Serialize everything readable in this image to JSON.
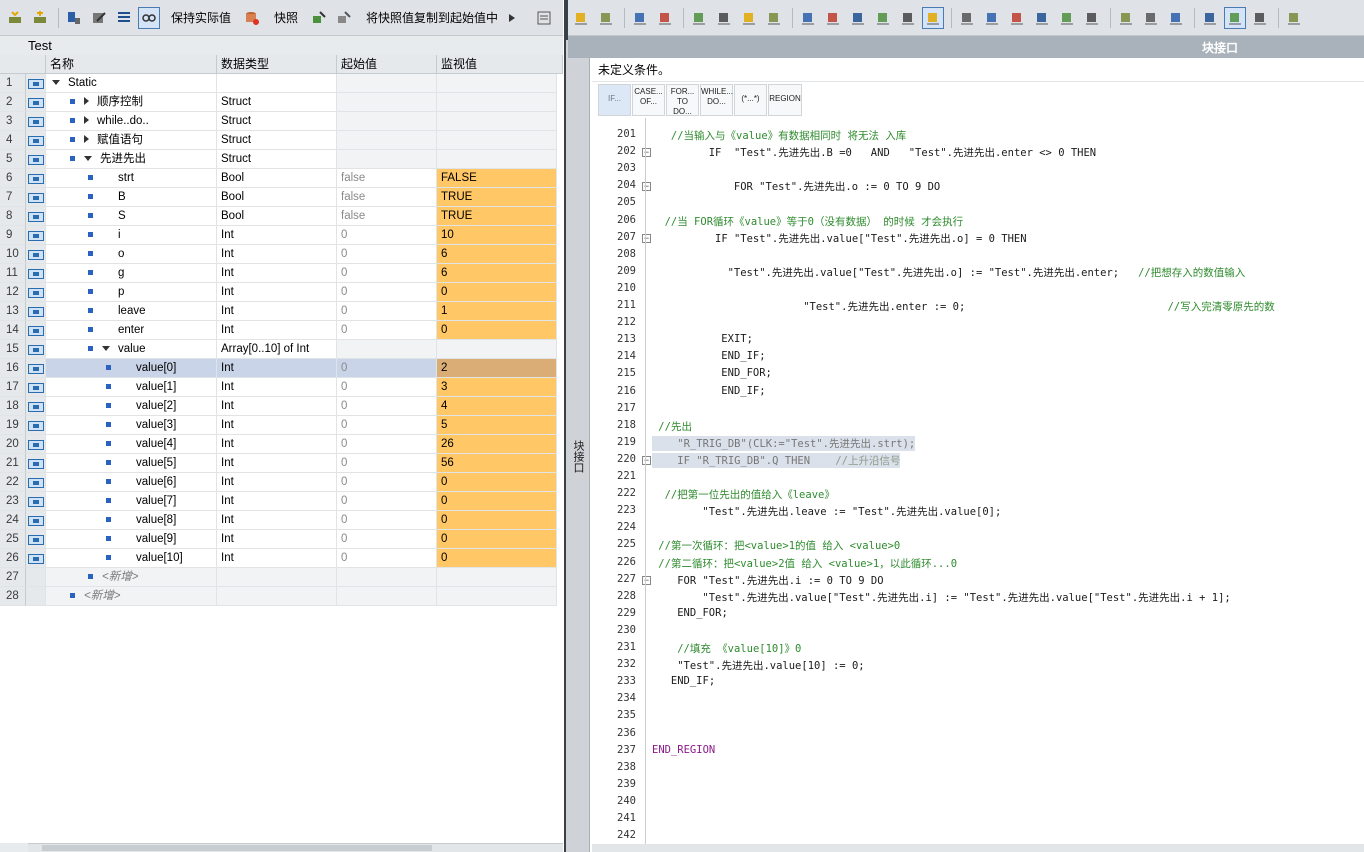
{
  "left_toolbar": {
    "keep_actual": "保持实际值",
    "snapshot": "快照",
    "copy_snapshot": "将快照值复制到起始值中"
  },
  "block_title": "Test",
  "columns": [
    "名称",
    "数据类型",
    "起始值",
    "监视值"
  ],
  "rows": [
    {
      "num": "1",
      "name": "Static",
      "type": "",
      "start": "",
      "monitor": "",
      "level": 0,
      "expander": "down",
      "marker": false
    },
    {
      "num": "2",
      "name": "顺序控制",
      "type": "Struct",
      "start": "",
      "monitor": "",
      "level": 1,
      "expander": "right",
      "marker": true
    },
    {
      "num": "3",
      "name": "while..do..",
      "type": "Struct",
      "start": "",
      "monitor": "",
      "level": 1,
      "expander": "right",
      "marker": true
    },
    {
      "num": "4",
      "name": "赋值语句",
      "type": "Struct",
      "start": "",
      "monitor": "",
      "level": 1,
      "expander": "right",
      "marker": true
    },
    {
      "num": "5",
      "name": "先进先出",
      "type": "Struct",
      "start": "",
      "monitor": "",
      "level": 1,
      "expander": "down",
      "marker": true
    },
    {
      "num": "6",
      "name": "strt",
      "type": "Bool",
      "start": "false",
      "monitor": "FALSE",
      "level": 2,
      "expander": "none",
      "marker": true
    },
    {
      "num": "7",
      "name": "B",
      "type": "Bool",
      "start": "false",
      "monitor": "TRUE",
      "level": 2,
      "expander": "none",
      "marker": true
    },
    {
      "num": "8",
      "name": "S",
      "type": "Bool",
      "start": "false",
      "monitor": "TRUE",
      "level": 2,
      "expander": "none",
      "marker": true
    },
    {
      "num": "9",
      "name": "i",
      "type": "Int",
      "start": "0",
      "monitor": "10",
      "level": 2,
      "expander": "none",
      "marker": true
    },
    {
      "num": "10",
      "name": "o",
      "type": "Int",
      "start": "0",
      "monitor": "6",
      "level": 2,
      "expander": "none",
      "marker": true
    },
    {
      "num": "11",
      "name": "g",
      "type": "Int",
      "start": "0",
      "monitor": "6",
      "level": 2,
      "expander": "none",
      "marker": true
    },
    {
      "num": "12",
      "name": "p",
      "type": "Int",
      "start": "0",
      "monitor": "0",
      "level": 2,
      "expander": "none",
      "marker": true
    },
    {
      "num": "13",
      "name": "leave",
      "type": "Int",
      "start": "0",
      "monitor": "1",
      "level": 2,
      "expander": "none",
      "marker": true
    },
    {
      "num": "14",
      "name": "enter",
      "type": "Int",
      "start": "0",
      "monitor": "0",
      "level": 2,
      "expander": "none",
      "marker": true
    },
    {
      "num": "15",
      "name": "value",
      "type": "Array[0..10] of Int",
      "start": "",
      "monitor": "",
      "level": 2,
      "expander": "down",
      "marker": true
    },
    {
      "num": "16",
      "name": "value[0]",
      "type": "Int",
      "start": "0",
      "monitor": "2",
      "level": 3,
      "expander": "none",
      "marker": true,
      "selected": true
    },
    {
      "num": "17",
      "name": "value[1]",
      "type": "Int",
      "start": "0",
      "monitor": "3",
      "level": 3,
      "expander": "none",
      "marker": true
    },
    {
      "num": "18",
      "name": "value[2]",
      "type": "Int",
      "start": "0",
      "monitor": "4",
      "level": 3,
      "expander": "none",
      "marker": true
    },
    {
      "num": "19",
      "name": "value[3]",
      "type": "Int",
      "start": "0",
      "monitor": "5",
      "level": 3,
      "expander": "none",
      "marker": true
    },
    {
      "num": "20",
      "name": "value[4]",
      "type": "Int",
      "start": "0",
      "monitor": "26",
      "level": 3,
      "expander": "none",
      "marker": true
    },
    {
      "num": "21",
      "name": "value[5]",
      "type": "Int",
      "start": "0",
      "monitor": "56",
      "level": 3,
      "expander": "none",
      "marker": true
    },
    {
      "num": "22",
      "name": "value[6]",
      "type": "Int",
      "start": "0",
      "monitor": "0",
      "level": 3,
      "expander": "none",
      "marker": true
    },
    {
      "num": "23",
      "name": "value[7]",
      "type": "Int",
      "start": "0",
      "monitor": "0",
      "level": 3,
      "expander": "none",
      "marker": true
    },
    {
      "num": "24",
      "name": "value[8]",
      "type": "Int",
      "start": "0",
      "monitor": "0",
      "level": 3,
      "expander": "none",
      "marker": true
    },
    {
      "num": "25",
      "name": "value[9]",
      "type": "Int",
      "start": "0",
      "monitor": "0",
      "level": 3,
      "expander": "none",
      "marker": true
    },
    {
      "num": "26",
      "name": "value[10]",
      "type": "Int",
      "start": "0",
      "monitor": "0",
      "level": 3,
      "expander": "none",
      "marker": true
    },
    {
      "num": "27",
      "name": "<新增>",
      "type": "",
      "start": "",
      "monitor": "",
      "level": 2,
      "expander": "none",
      "marker": true,
      "add": true
    },
    {
      "num": "28",
      "name": "<新增>",
      "type": "",
      "start": "",
      "monitor": "",
      "level": 1,
      "expander": "none",
      "marker": true,
      "add": true
    }
  ],
  "side_tab": "块接口",
  "interface_bar": {
    "label": "块接口"
  },
  "condition_text": "未定义条件。",
  "snippets": [
    {
      "l1": "IF...",
      "l2": ""
    },
    {
      "l1": "CASE...",
      "l2": "OF..."
    },
    {
      "l1": "FOR...",
      "l2": "TO DO..."
    },
    {
      "l1": "WHILE...",
      "l2": "DO..."
    },
    {
      "l1": "(*...*)",
      "l2": ""
    },
    {
      "l1": "REGION",
      "l2": ""
    }
  ],
  "code_lines": [
    {
      "n": "201",
      "indent": 3,
      "text": "//当输入与《value》有数据相同时 将无法 入库",
      "cls": "cm"
    },
    {
      "n": "202",
      "indent": 9,
      "text": "IF  \"Test\".先进先出.B =0   AND   \"Test\".先进先出.enter <> 0 THEN",
      "fold": "-"
    },
    {
      "n": "203",
      "indent": 0,
      "text": ""
    },
    {
      "n": "204",
      "indent": 13,
      "text": "FOR \"Test\".先进先出.o := 0 TO 9 DO",
      "fold": "-"
    },
    {
      "n": "205",
      "indent": 0,
      "text": ""
    },
    {
      "n": "206",
      "indent": 2,
      "text": "//当 FOR循环《value》等于0（没有数据） 的时候 才会执行",
      "cls": "cm"
    },
    {
      "n": "207",
      "indent": 10,
      "text": "IF \"Test\".先进先出.value[\"Test\".先进先出.o] = 0 THEN",
      "fold": "-"
    },
    {
      "n": "208",
      "indent": 0,
      "text": ""
    },
    {
      "n": "209",
      "indent": 12,
      "text": "\"Test\".先进先出.value[\"Test\".先进先出.o] := \"Test\".先进先出.enter;   ",
      "tail": "//把想存入的数值输入"
    },
    {
      "n": "210",
      "indent": 0,
      "text": ""
    },
    {
      "n": "211",
      "indent": 24,
      "text": "\"Test\".先进先出.enter := 0;                                ",
      "tail": "//写入完清零原先的数"
    },
    {
      "n": "212",
      "indent": 0,
      "text": ""
    },
    {
      "n": "213",
      "indent": 11,
      "text": "EXIT;"
    },
    {
      "n": "214",
      "indent": 11,
      "text": "END_IF;"
    },
    {
      "n": "215",
      "indent": 11,
      "text": "END_FOR;"
    },
    {
      "n": "216",
      "indent": 11,
      "text": "END_IF;"
    },
    {
      "n": "217",
      "indent": 0,
      "text": ""
    },
    {
      "n": "218",
      "indent": 1,
      "text": "//先出",
      "cls": "cm"
    },
    {
      "n": "219",
      "indent": 0,
      "text": "    \"R_TRIG_DB\"(CLK:=\"Test\".先进先出.strt);",
      "hl": true
    },
    {
      "n": "220",
      "indent": 0,
      "text": "    IF \"R_TRIG_DB\".Q THEN    ",
      "tail": "//上升沿信号",
      "hl": true,
      "fold": "-"
    },
    {
      "n": "221",
      "indent": 0,
      "text": ""
    },
    {
      "n": "222",
      "indent": 2,
      "text": "//把第一位先出的值给入《leave》",
      "cls": "cm"
    },
    {
      "n": "223",
      "indent": 8,
      "text": "\"Test\".先进先出.leave := \"Test\".先进先出.value[0];"
    },
    {
      "n": "224",
      "indent": 0,
      "text": ""
    },
    {
      "n": "225",
      "indent": 1,
      "text": "//第一次循环：把<value>1的值 给入 <value>0",
      "cls": "cm"
    },
    {
      "n": "226",
      "indent": 1,
      "text": "//第二循环：把<value>2值 给入 <value>1，以此循环...0",
      "cls": "cm"
    },
    {
      "n": "227",
      "indent": 4,
      "text": "FOR \"Test\".先进先出.i := 0 TO 9 DO",
      "fold": "-"
    },
    {
      "n": "228",
      "indent": 8,
      "text": "\"Test\".先进先出.value[\"Test\".先进先出.i] := \"Test\".先进先出.value[\"Test\".先进先出.i + 1];"
    },
    {
      "n": "229",
      "indent": 4,
      "text": "END_FOR;"
    },
    {
      "n": "230",
      "indent": 0,
      "text": ""
    },
    {
      "n": "231",
      "indent": 4,
      "text": "//填充 《value[10]》0",
      "cls": "cm"
    },
    {
      "n": "232",
      "indent": 4,
      "text": "\"Test\".先进先出.value[10] := 0;"
    },
    {
      "n": "233",
      "indent": 3,
      "text": "END_IF;"
    },
    {
      "n": "234",
      "indent": 0,
      "text": ""
    },
    {
      "n": "235",
      "indent": 0,
      "text": ""
    },
    {
      "n": "236",
      "indent": 0,
      "text": ""
    },
    {
      "n": "237",
      "indent": 0,
      "text": "END_REGION",
      "cls": "pur"
    },
    {
      "n": "238",
      "indent": 0,
      "text": ""
    },
    {
      "n": "239",
      "indent": 0,
      "text": ""
    },
    {
      "n": "240",
      "indent": 0,
      "text": ""
    },
    {
      "n": "241",
      "indent": 0,
      "text": ""
    },
    {
      "n": "242",
      "indent": 0,
      "text": ""
    }
  ],
  "colors": {
    "monitor_fill": "#ffc766",
    "selected_row": "#c9d4e8",
    "comment": "#2e8b2e",
    "region": "#8b1a8b",
    "marker_blue": "#2a62c2"
  }
}
